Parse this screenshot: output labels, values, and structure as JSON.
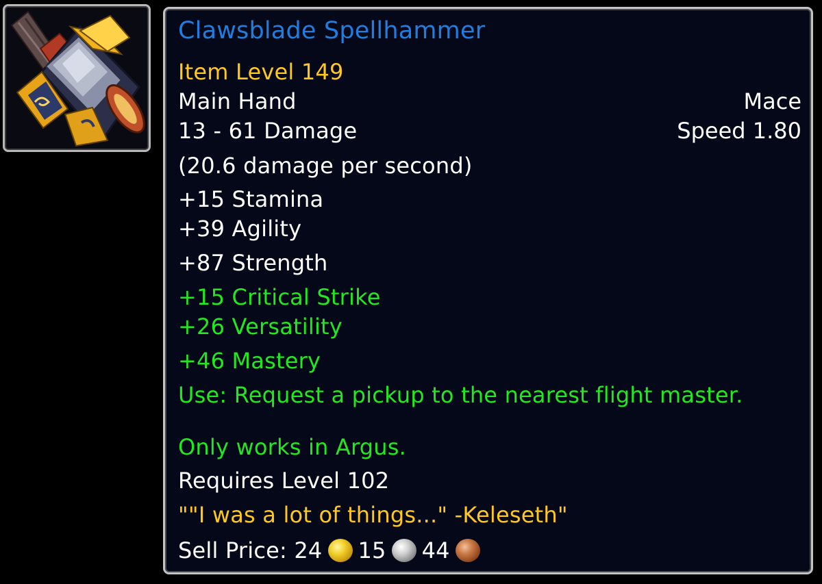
{
  "item": {
    "icon": "mace-icon",
    "name": "Clawsblade Spellhammer",
    "item_level": "Item Level 149",
    "slot": "Main Hand",
    "type": "Mace",
    "damage": "13 - 61 Damage",
    "speed": "Speed 1.80",
    "dps": "(20.6 damage per second)",
    "stats": [
      "+15 Stamina",
      "+39 Agility",
      "+87 Strength"
    ],
    "secondary_stats": [
      "+15 Critical Strike",
      "+26 Versatility",
      "+46 Mastery"
    ],
    "use_effect": "Use: Request a pickup to the nearest flight master.",
    "use_note": "Only works in Argus.",
    "requires_level": "Requires Level 102",
    "flavor_text": "\"\"I was a lot of things...\" -Keleseth\"",
    "sell_price": {
      "label": "Sell Price:",
      "gold": "24",
      "silver": "15",
      "copper": "44"
    }
  },
  "colors": {
    "name": "#1f7ee0",
    "item_level": "#ffc81e",
    "base_text": "#ffffff",
    "bonus_text": "#22e81e",
    "flavor": "#ffc81e",
    "background": "#050819",
    "border": "#c4c4c4"
  }
}
